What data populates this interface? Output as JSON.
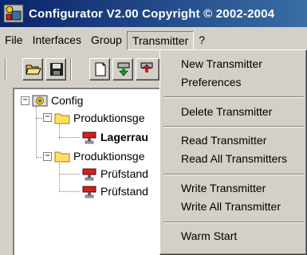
{
  "window": {
    "title": "Configurator  V2.00 Copyright © 2002-2004"
  },
  "menubar": {
    "items": [
      "File",
      "Interfaces",
      "Group",
      "Transmitter",
      "?"
    ],
    "open_item": "Transmitter"
  },
  "toolbar": {
    "buttons": [
      "open-folder-icon",
      "save-disk-icon",
      "new-document-icon",
      "transmitter-green-arrow-icon",
      "transmitter-red-arrow-icon"
    ]
  },
  "tree": {
    "root": "Config",
    "nodes": [
      {
        "label": "Produktionsge",
        "level": 1,
        "expanded": true
      },
      {
        "label": "Lagerrau",
        "level": 2,
        "bold": true
      },
      {
        "label": "Produktionsge",
        "level": 1,
        "expanded": true
      },
      {
        "label": "Prüfstand",
        "level": 2
      },
      {
        "label": "Prüfstand",
        "level": 2
      }
    ]
  },
  "transmitter_menu": {
    "items": [
      "New Transmitter",
      "Preferences",
      "Delete Transmitter",
      "Read Transmitter",
      "Read All Transmitters",
      "Write Transmitter",
      "Write All Transmitter",
      "Warm Start"
    ]
  }
}
